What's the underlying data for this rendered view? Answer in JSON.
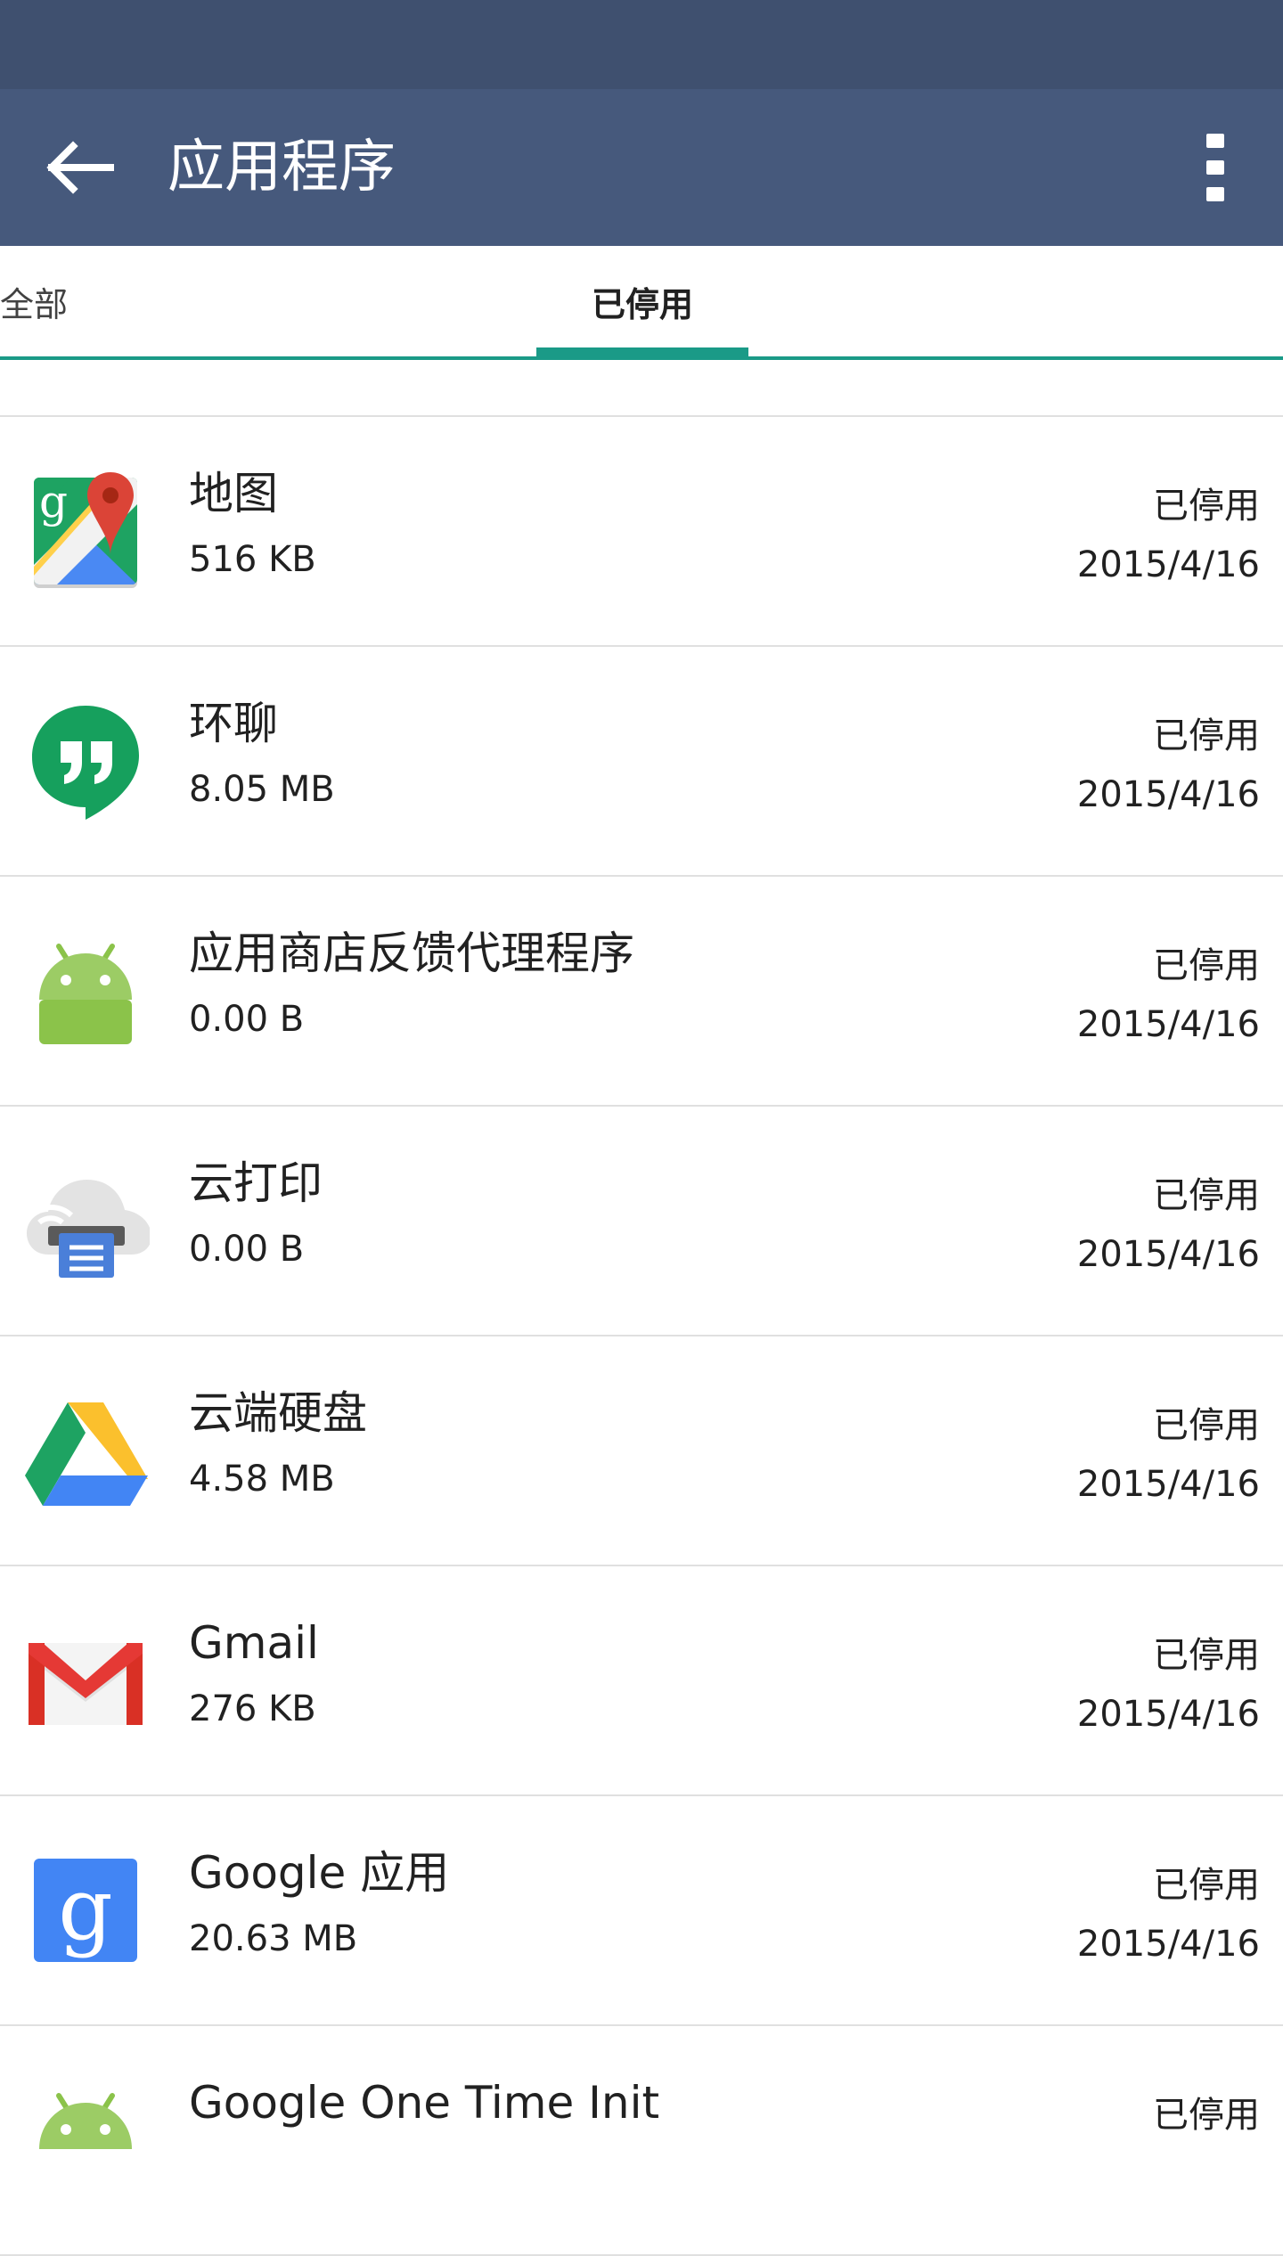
{
  "toolbar": {
    "title": "应用程序",
    "back_icon": "arrow-left-icon",
    "menu_icon": "more-vert-icon"
  },
  "colors": {
    "status_bar": "#3f506f",
    "toolbar": "#46597c",
    "tab_accent": "#1a9a87"
  },
  "tabs": [
    {
      "label": "全部",
      "selected": false
    },
    {
      "label": "已停用",
      "selected": true
    }
  ],
  "apps": [
    {
      "name": "地图",
      "size": "516 KB",
      "status": "已停用",
      "date": "2015/4/16",
      "icon": "google-maps-icon"
    },
    {
      "name": "环聊",
      "size": "8.05 MB",
      "status": "已停用",
      "date": "2015/4/16",
      "icon": "hangouts-icon"
    },
    {
      "name": "应用商店反馈代理程序",
      "size": "0.00 B",
      "status": "已停用",
      "date": "2015/4/16",
      "icon": "android-icon"
    },
    {
      "name": "云打印",
      "size": "0.00 B",
      "status": "已停用",
      "date": "2015/4/16",
      "icon": "cloud-print-icon"
    },
    {
      "name": "云端硬盘",
      "size": "4.58 MB",
      "status": "已停用",
      "date": "2015/4/16",
      "icon": "google-drive-icon"
    },
    {
      "name": "Gmail",
      "size": "276 KB",
      "status": "已停用",
      "date": "2015/4/16",
      "icon": "gmail-icon"
    },
    {
      "name": "Google 应用",
      "size": "20.63 MB",
      "status": "已停用",
      "date": "2015/4/16",
      "icon": "google-search-icon"
    },
    {
      "name": "Google One Time Init",
      "size": "",
      "status": "已停用",
      "date": "",
      "icon": "android-icon"
    }
  ]
}
